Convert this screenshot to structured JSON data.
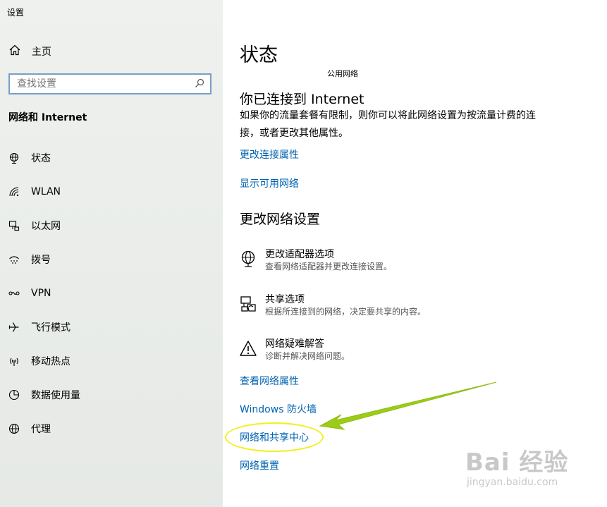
{
  "window": {
    "title": "设置"
  },
  "sidebar": {
    "home_label": "主页",
    "search_placeholder": "查找设置",
    "section_heading": "网络和 Internet",
    "items": [
      {
        "label": "状态",
        "icon": "globe-status-icon"
      },
      {
        "label": "WLAN",
        "icon": "wifi-icon"
      },
      {
        "label": "以太网",
        "icon": "ethernet-icon"
      },
      {
        "label": "拨号",
        "icon": "dialup-icon"
      },
      {
        "label": "VPN",
        "icon": "vpn-icon"
      },
      {
        "label": "飞行模式",
        "icon": "airplane-icon"
      },
      {
        "label": "移动热点",
        "icon": "hotspot-icon"
      },
      {
        "label": "数据使用量",
        "icon": "data-usage-icon"
      },
      {
        "label": "代理",
        "icon": "proxy-globe-icon"
      }
    ]
  },
  "main": {
    "title": "状态",
    "network_name": "公用网络",
    "connected_heading": "你已连接到 Internet",
    "description": "如果你的流量套餐有限制，则你可以将此网络设置为按流量计费的连接，或者更改其他属性。",
    "link_change_properties": "更改连接属性",
    "link_show_networks": "显示可用网络",
    "change_settings_heading": "更改网络设置",
    "options": [
      {
        "title": "更改适配器选项",
        "desc": "查看网络适配器并更改连接设置。",
        "icon": "adapter-globe-icon"
      },
      {
        "title": "共享选项",
        "desc": "根据所连接到的网络，决定要共享的内容。",
        "icon": "sharing-icon"
      },
      {
        "title": "网络疑难解答",
        "desc": "诊断并解决网络问题。",
        "icon": "warning-icon"
      }
    ],
    "links": {
      "view_properties": "查看网络属性",
      "firewall": "Windows 防火墙",
      "sharing_center": "网络和共享中心",
      "reset": "网络重置"
    }
  },
  "watermark": {
    "brand": "Bai 经验",
    "url": "jingyan.baidu.com"
  },
  "colors": {
    "link": "#0063b1",
    "highlight_ellipse": "#f3ef1a",
    "arrow": "#9ccc1a"
  }
}
